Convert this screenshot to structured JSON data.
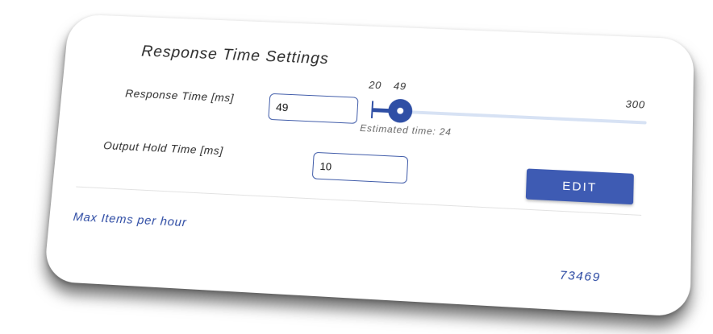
{
  "settings": {
    "title": "Response Time Settings",
    "response_time": {
      "label": "Response Time [ms]",
      "value": "49",
      "slider": {
        "min": 20,
        "max": 300,
        "value": 49,
        "min_label": "20",
        "value_label": "49",
        "max_label": "300"
      },
      "estimated_text": "Estimated time: 24"
    },
    "output_hold_time": {
      "label": "Output Hold Time [ms]",
      "value": "10"
    },
    "edit_label": "EDIT"
  },
  "stats": {
    "max_items_label": "Max Items per hour",
    "max_items_value": "73469"
  },
  "colors": {
    "accent": "#3e5bb3",
    "link_text": "#2c4aa3",
    "track": "#d7e2f4"
  }
}
